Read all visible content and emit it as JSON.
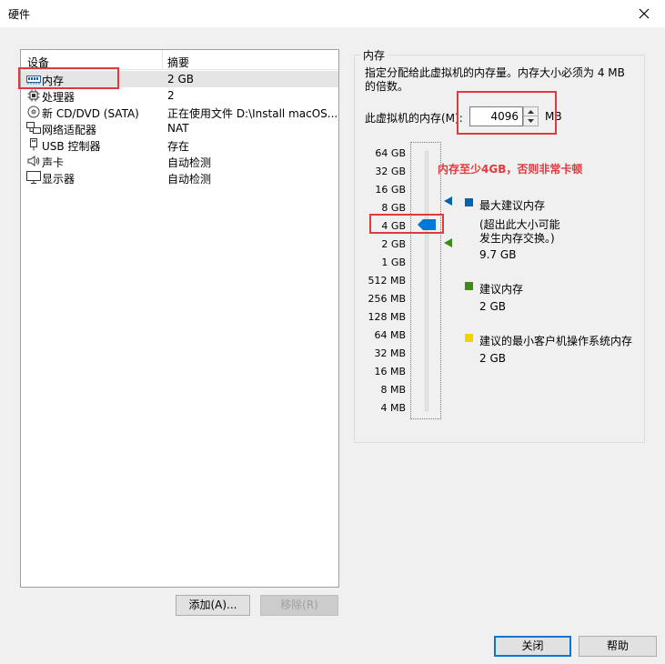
{
  "window": {
    "title": "硬件"
  },
  "device_table": {
    "headers": [
      "设备",
      "摘要"
    ],
    "rows": [
      {
        "name": "内存",
        "summary": "2 GB",
        "icon": "memory-icon",
        "selected": true
      },
      {
        "name": "处理器",
        "summary": "2",
        "icon": "processor-icon"
      },
      {
        "name": "新 CD/DVD (SATA)",
        "summary": "正在使用文件 D:\\Install macOS...",
        "icon": "cd-dvd-icon"
      },
      {
        "name": "网络适配器",
        "summary": "NAT",
        "icon": "network-adapter-icon"
      },
      {
        "name": "USB 控制器",
        "summary": "存在",
        "icon": "usb-icon"
      },
      {
        "name": "声卡",
        "summary": "自动检测",
        "icon": "sound-card-icon"
      },
      {
        "name": "显示器",
        "summary": "自动检测",
        "icon": "display-icon"
      }
    ]
  },
  "buttons": {
    "add": "添加(A)...",
    "remove": "移除(R)",
    "close": "关闭",
    "help": "帮助"
  },
  "memory": {
    "group_title": "内存",
    "description": "指定分配给此虚拟机的内存量。内存大小必须为 4 MB 的倍数。",
    "field_label": "此虚拟机的内存(M):",
    "value": "4096",
    "unit": "MB",
    "annotation": "内存至少4GB，否则非常卡顿",
    "ticks": [
      "64 GB",
      "32 GB",
      "16 GB",
      "8 GB",
      "4 GB",
      "2 GB",
      "1 GB",
      "512 MB",
      "256 MB",
      "128 MB",
      "64 MB",
      "32 MB",
      "16 MB",
      "8 MB",
      "4 MB"
    ],
    "slider_value": "4 GB",
    "legend": {
      "max_recommended": {
        "label": "最大建议内存",
        "note_line1": "(超出此大小可能",
        "note_line2": "发生内存交换。)",
        "value": "9.7 GB",
        "color": "#0063b1"
      },
      "recommended": {
        "label": "建议内存",
        "value": "2 GB",
        "color": "#3c8c1a"
      },
      "min_guest": {
        "label": "建议的最小客户机操作系统内存",
        "value": "2 GB",
        "color": "#f2d100"
      }
    }
  },
  "colors": {
    "annotation_red": "#e0393e",
    "accent_blue": "#0078d7"
  }
}
